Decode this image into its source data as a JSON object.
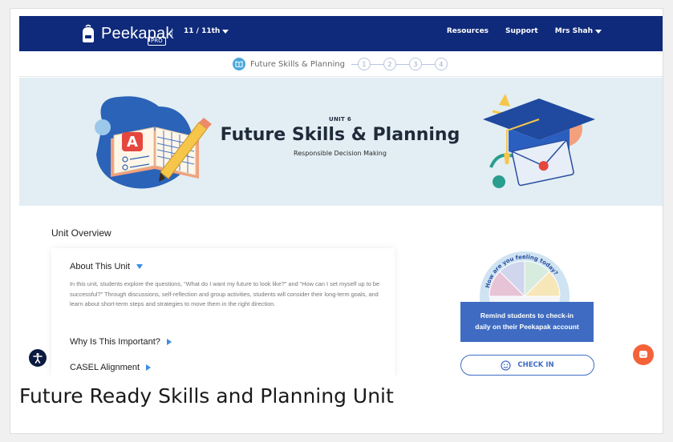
{
  "colors": {
    "nav": "#0f2a7a",
    "hero": "#e2eef3",
    "accent": "#3f6cc2",
    "chat": "#f4623a"
  },
  "nav": {
    "logo_text": "Peekapak",
    "badge": "PRO",
    "grade": "11 / 11th",
    "resources": "Resources",
    "support": "Support",
    "user": "Mrs Shah"
  },
  "steps": {
    "current_label": "Future Skills & Planning",
    "items": [
      "1",
      "2",
      "3",
      "4"
    ]
  },
  "hero": {
    "unit": "UNIT 6",
    "title": "Future Skills & Planning",
    "subtitle": "Responsible Decision Making"
  },
  "overview": {
    "title": "Unit Overview",
    "about_heading": "About This Unit",
    "about_body": "In this unit, students explore the questions, “What do I want my future to look like?” and “How can I set myself up to be successful?” Through discussions, self-reflection and group activities, students will consider their long-term goals, and learn about short-term steps and strategies to move them in the right direction.",
    "why_heading": "Why Is This Important?",
    "casel_heading": "CASEL Alignment"
  },
  "checkin": {
    "wheel_text": "How are you feeling today?",
    "remind_line1": "Remind students to check-in",
    "remind_line2": "daily on their Peekapak account",
    "button_label": "CHECK IN"
  },
  "caption": "Future Ready Skills and Planning Unit",
  "icons": [
    "backpack-logo-icon",
    "book-icon",
    "accessibility-icon",
    "smile-icon",
    "chat-icon"
  ]
}
